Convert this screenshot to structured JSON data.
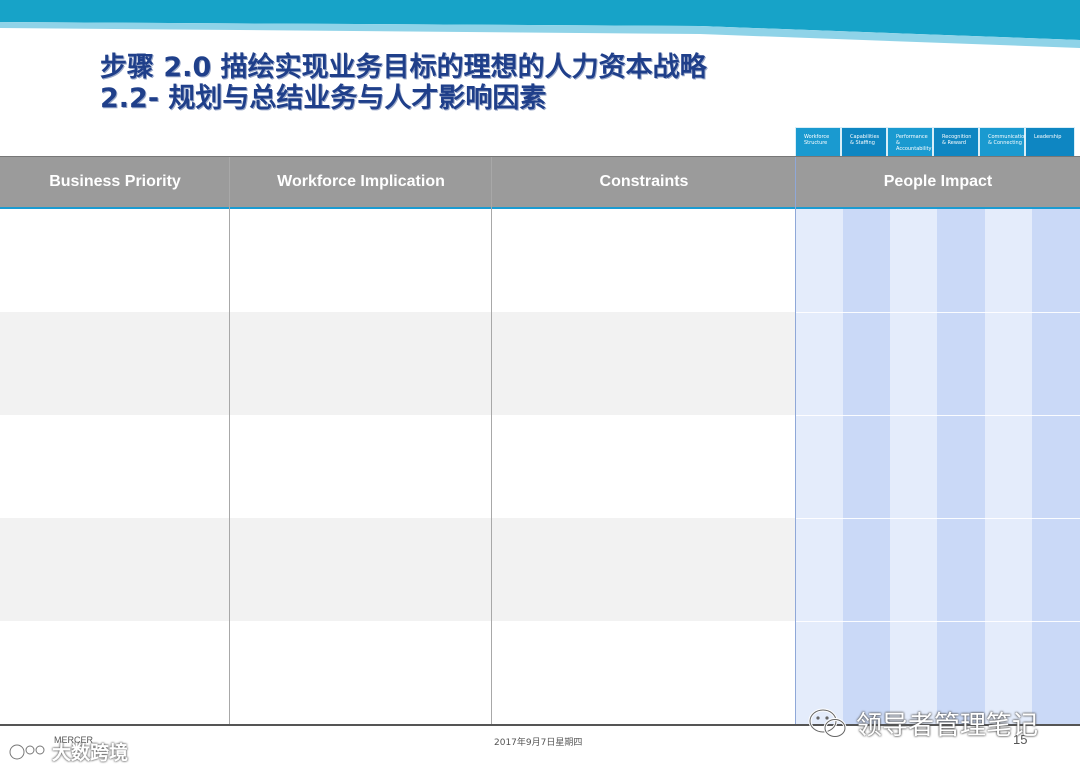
{
  "title": {
    "line1": "步骤 2.0 描绘实现业务目标的理想的人力资本战略",
    "line2": "2.2- 规划与总结业务与人才影响因素"
  },
  "tabs": [
    {
      "line1": "Workforce",
      "line2": "Structure"
    },
    {
      "line1": "Capabilities",
      "line2": "& Staffing"
    },
    {
      "line1": "Performance &",
      "line2": "Accountability"
    },
    {
      "line1": "Recognition",
      "line2": "& Reward"
    },
    {
      "line1": "Communication",
      "line2": "& Connecting"
    },
    {
      "line1": "Leadership",
      "line2": ""
    }
  ],
  "table": {
    "headers": [
      "Business Priority",
      "Workforce Implication",
      "Constraints",
      "People Impact"
    ]
  },
  "footer": {
    "brand": "MERCER",
    "date": "2017年9月7日星期四",
    "page": "15"
  },
  "watermarks": {
    "left": "大数跨境",
    "right": "领导者管理笔记"
  },
  "colors": {
    "header_bg": "#9b9b9b",
    "title": "#1f3f8a",
    "accent": "#1b9bd1",
    "tab": "#1a9ad0"
  }
}
